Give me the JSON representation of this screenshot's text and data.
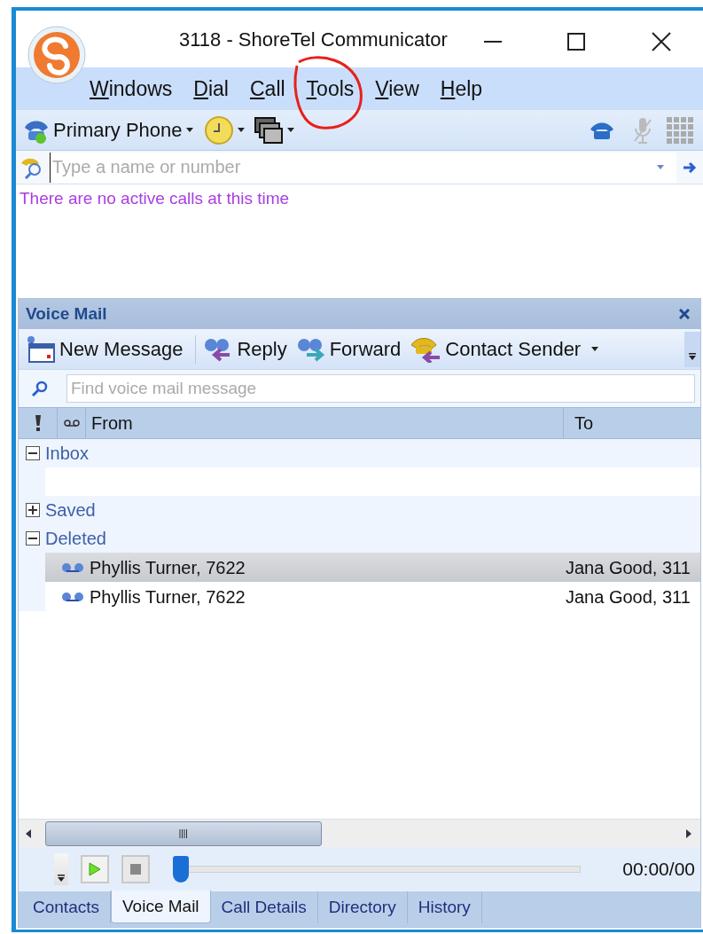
{
  "window": {
    "title": "3118 - ShoreTel Communicator"
  },
  "menu": [
    "Windows",
    "Dial",
    "Call",
    "Tools",
    "View",
    "Help"
  ],
  "toolbar": {
    "phone_label": "Primary Phone"
  },
  "dial": {
    "placeholder": "Type a name or number"
  },
  "status_message": "There are no active calls at this time",
  "voice_mail": {
    "title": "Voice Mail",
    "actions": [
      {
        "kind": "new",
        "label": "New Message",
        "dropdown": false
      },
      {
        "kind": "reply",
        "label": "Reply",
        "dropdown": false
      },
      {
        "kind": "forward",
        "label": "Forward",
        "dropdown": false
      },
      {
        "kind": "contact",
        "label": "Contact Sender",
        "dropdown": true
      }
    ],
    "search": {
      "placeholder": "Find voice mail message"
    },
    "columns": [
      "From",
      "To"
    ],
    "groups": [
      {
        "label": "Inbox",
        "expanded": true
      },
      {
        "label": "Saved",
        "expanded": false
      },
      {
        "label": "Deleted",
        "expanded": true,
        "messages": [
          {
            "from": "Phyllis Turner, 7622",
            "to": "Jana Good, 311",
            "selected": true
          },
          {
            "from": "Phyllis Turner, 7622",
            "to": "Jana Good, 311",
            "selected": false
          }
        ]
      }
    ],
    "player": {
      "time": "00:00/00",
      "level": 0
    }
  },
  "tabs": [
    {
      "label": "Contacts",
      "selected": false
    },
    {
      "label": "Voice Mail",
      "selected": true
    },
    {
      "label": "Call Details",
      "selected": false
    },
    {
      "label": "Directory",
      "selected": false
    },
    {
      "label": "History",
      "selected": false
    }
  ]
}
